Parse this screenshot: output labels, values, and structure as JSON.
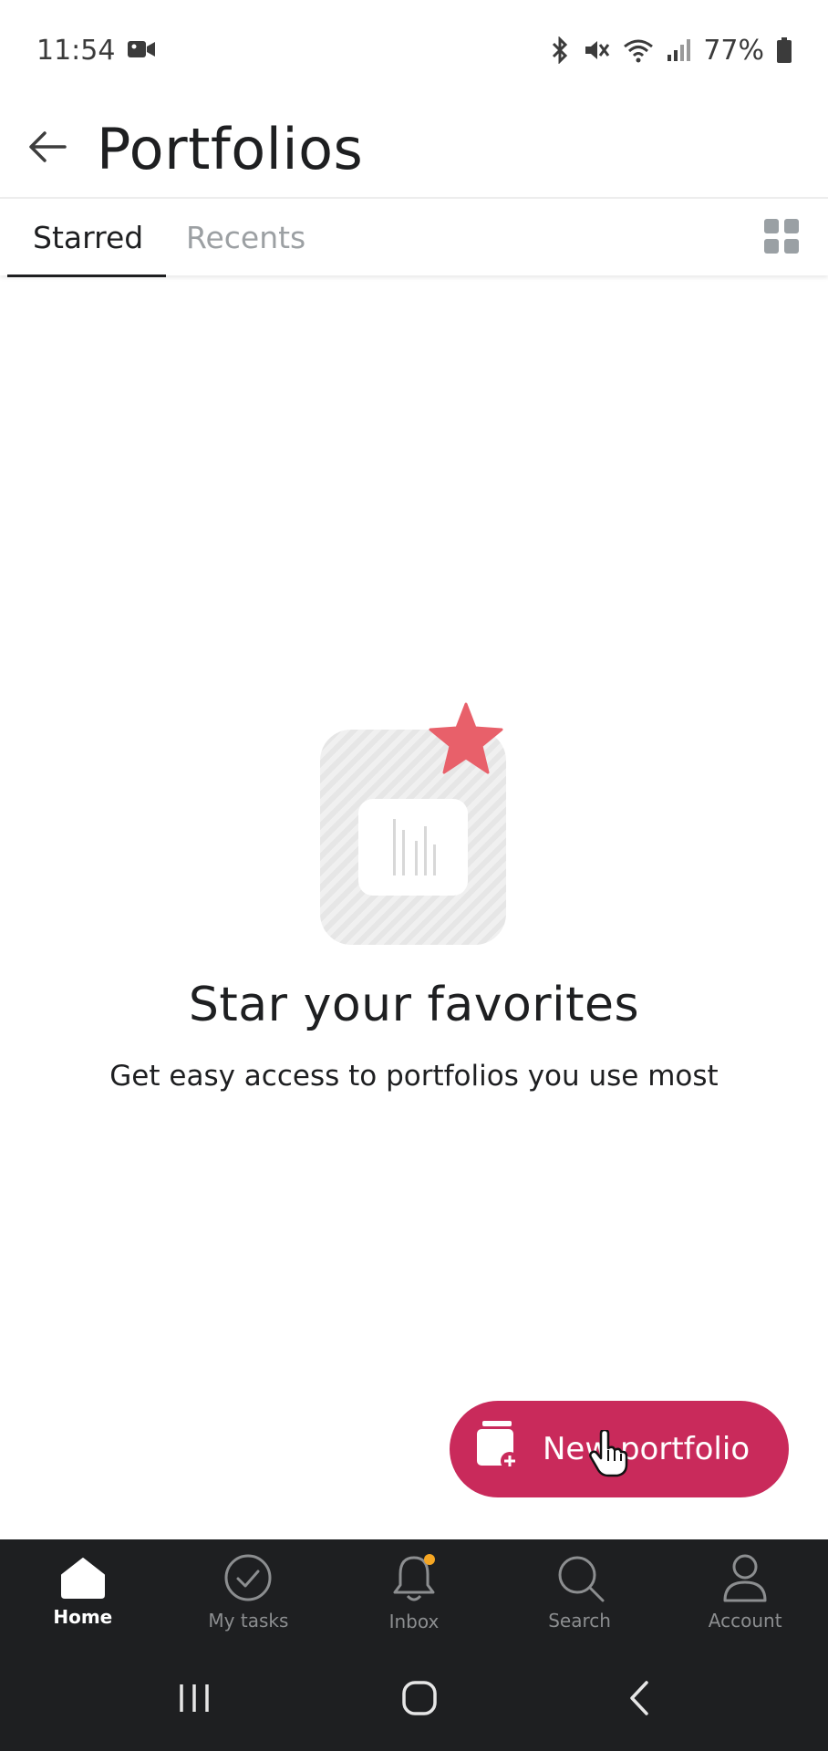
{
  "status_bar": {
    "time": "11:54",
    "battery": "77%"
  },
  "header": {
    "title": "Portfolios"
  },
  "tabs": [
    {
      "label": "Starred",
      "active": true
    },
    {
      "label": "Recents",
      "active": false
    }
  ],
  "empty_state": {
    "title": "Star your favorites",
    "subtitle": "Get easy access to portfolios you use most"
  },
  "fab": {
    "label": "New portfolio"
  },
  "bottom_nav": {
    "items": [
      {
        "label": "Home",
        "icon": "home-icon",
        "active": true
      },
      {
        "label": "My tasks",
        "icon": "check-circle-icon",
        "active": false
      },
      {
        "label": "Inbox",
        "icon": "bell-icon",
        "active": false
      },
      {
        "label": "Search",
        "icon": "search-icon",
        "active": false
      },
      {
        "label": "Account",
        "icon": "person-icon",
        "active": false
      }
    ]
  },
  "colors": {
    "accent": "#c92a5b",
    "star": "#e8606a",
    "nav_background": "#1e1f21",
    "inbox_dot": "#f5a623"
  }
}
